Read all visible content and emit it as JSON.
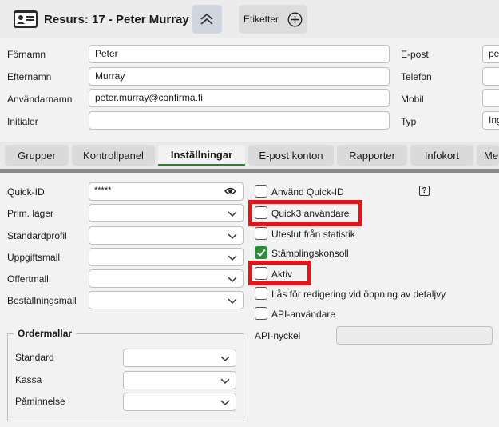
{
  "header": {
    "title": "Resurs: 17 - Peter Murray",
    "tags_label": "Etiketter"
  },
  "person": {
    "firstname_label": "Förnamn",
    "firstname_value": "Peter",
    "lastname_label": "Efternamn",
    "lastname_value": "Murray",
    "username_label": "Användarnamn",
    "username_value": "peter.murray@confirma.fi",
    "initials_label": "Initialer",
    "initials_value": "",
    "email_label": "E-post",
    "email_value": "pe",
    "phone_label": "Telefon",
    "phone_value": "",
    "mobile_label": "Mobil",
    "mobile_value": "",
    "type_label": "Typ",
    "type_value": "Ing"
  },
  "tabs": [
    {
      "label": "Grupper"
    },
    {
      "label": "Kontrollpanel"
    },
    {
      "label": "Inställningar"
    },
    {
      "label": "E-post konton"
    },
    {
      "label": "Rapporter"
    },
    {
      "label": "Infokort"
    },
    {
      "label": "Me"
    }
  ],
  "settings": {
    "quickid_label": "Quick-ID",
    "quickid_value": "*****",
    "stock_label": "Prim. lager",
    "stock_value": "",
    "profile_label": "Standardprofil",
    "profile_value": "",
    "task_template_label": "Uppgiftsmall",
    "task_template_value": "",
    "offer_template_label": "Offertmall",
    "offer_template_value": "",
    "order_template_label": "Beställningsmall",
    "order_template_value": ""
  },
  "ordermallar": {
    "legend": "Ordermallar",
    "standard_label": "Standard",
    "standard_value": "",
    "kassa_label": "Kassa",
    "kassa_value": "",
    "reminder_label": "Påminnelse",
    "reminder_value": ""
  },
  "checkboxes": [
    {
      "label": "Använd Quick-ID",
      "checked": false,
      "highlighted": false
    },
    {
      "label": "Quick3 användare",
      "checked": false,
      "highlighted": true
    },
    {
      "label": "Uteslut från statistik",
      "checked": false,
      "highlighted": false
    },
    {
      "label": "Stämplingskonsoll",
      "checked": true,
      "highlighted": false
    },
    {
      "label": "Aktiv",
      "checked": false,
      "highlighted": true
    },
    {
      "label": "Lås för redigering vid öppning av detaljvy",
      "checked": false,
      "highlighted": false
    },
    {
      "label": "API-användare",
      "checked": false,
      "highlighted": false
    }
  ],
  "api": {
    "key_label": "API-nyckel",
    "key_value": ""
  },
  "help_glyph": "?",
  "colors": {
    "check_green": "#2e8b3a",
    "highlight_red": "#e0161b",
    "active_tab_underline": "#2e7d32"
  }
}
